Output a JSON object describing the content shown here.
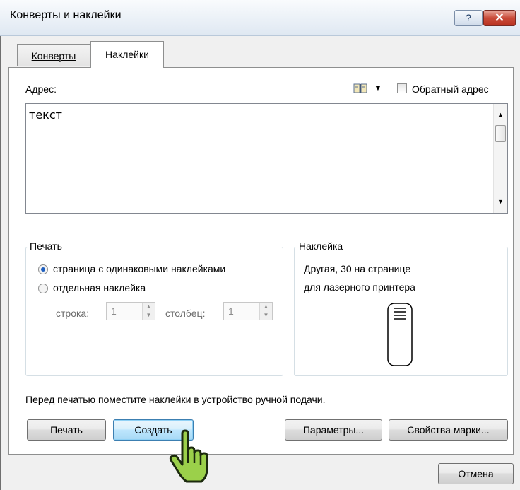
{
  "window": {
    "title": "Конверты и наклейки",
    "help_label": "?",
    "close_label": "✕"
  },
  "tabs": [
    {
      "label": "Конверты",
      "active": false
    },
    {
      "label": "Наклейки",
      "active": true
    }
  ],
  "address": {
    "label": "Адрес:",
    "value": "текст",
    "address_book_icon": "address-book-icon",
    "return_address_label": "Обратный адрес",
    "return_address_checked": false
  },
  "print_group": {
    "title": "Печать",
    "options": [
      {
        "label": "страница с одинаковыми наклейками",
        "selected": true
      },
      {
        "label": "отдельная наклейка",
        "selected": false
      }
    ],
    "row_label": "строка:",
    "row_value": "1",
    "column_label": "столбец:",
    "column_value": "1"
  },
  "label_group": {
    "title": "Наклейка",
    "line1": "Другая, 30 на странице",
    "line2": "для лазерного принтера"
  },
  "hint": "Перед печатью поместите наклейки в устройство ручной подачи.",
  "buttons": {
    "print": "Печать",
    "create": "Создать",
    "options": "Параметры...",
    "stamp_properties": "Свойства марки...",
    "cancel": "Отмена"
  },
  "colors": {
    "accent": "#3c7fb1",
    "radio_selected": "#1f5fbf",
    "cursor_fill": "#9bd04a"
  }
}
